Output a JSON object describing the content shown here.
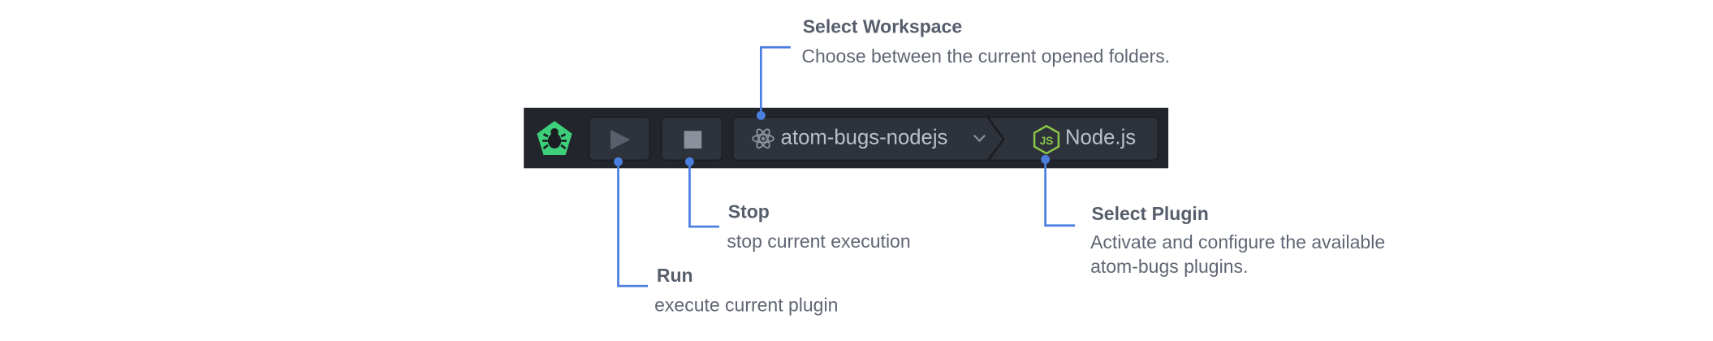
{
  "toolbar": {
    "workspace_label": "atom-bugs-nodejs",
    "plugin_label": "Node.js"
  },
  "annotations": {
    "select_workspace": {
      "title": "Select Workspace",
      "description": "Choose between the current opened folders."
    },
    "stop": {
      "title": "Stop",
      "description": "stop current execution"
    },
    "run": {
      "title": "Run",
      "description": "execute current plugin"
    },
    "select_plugin": {
      "title": "Select Plugin",
      "description_line1": "Activate and configure the available",
      "description_line2": "atom-bugs plugins."
    }
  },
  "icons": {
    "logo": "bug-pentagon-icon",
    "run": "play-icon",
    "stop": "stop-square-icon",
    "workspace": "atom-icon",
    "dropdown": "chevron-down-icon",
    "plugin": "nodejs-hexagon-icon"
  },
  "colors": {
    "toolbar_bg": "#22252b",
    "button_bg": "#2e323a",
    "logo_green": "#3ecf7a",
    "nodejs_green": "#8cc84b",
    "callout_blue": "#4a7fe0",
    "annotation_text": "#565d6b"
  }
}
